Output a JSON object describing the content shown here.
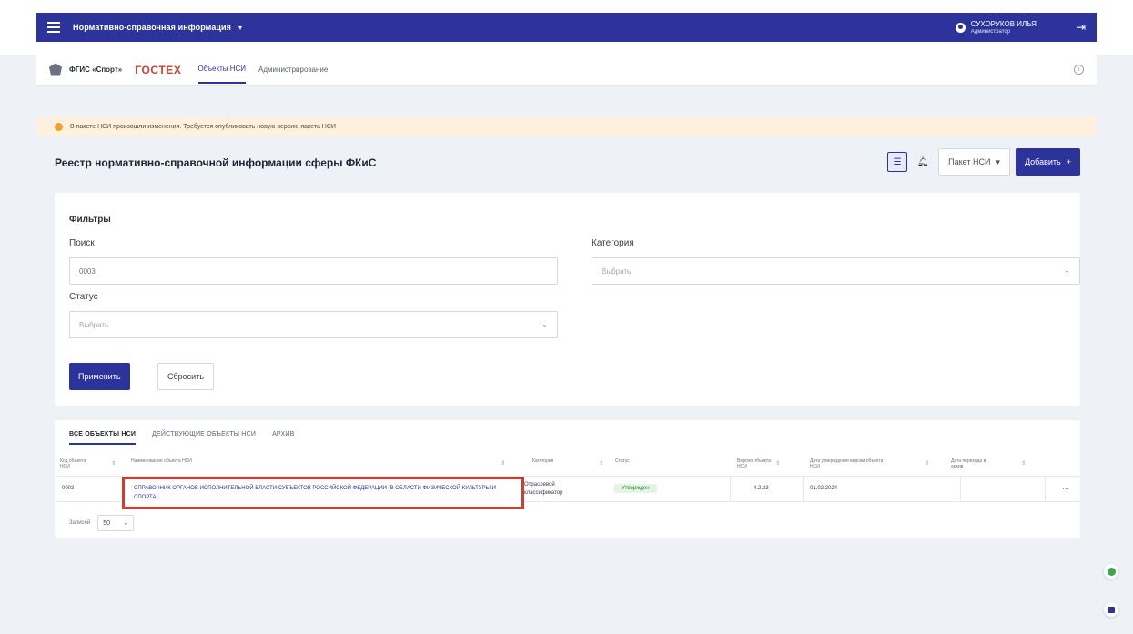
{
  "topbar": {
    "app_title": "Нормативно-справочная информация",
    "user_name": "СУХОРУКОВ ИЛЬЯ",
    "user_role": "Администратор"
  },
  "nav": {
    "brand": "ФГИС «Спорт»",
    "gostech": "ГОСТЕХ",
    "links": [
      "Объекты НСИ",
      "Администрирование"
    ]
  },
  "alert": {
    "text": "В пакете НСИ произошли изменения. Требуется опубликовать новую версию пакета НСИ"
  },
  "page": {
    "title": "Реестр нормативно-справочной информации сферы ФКиС",
    "package_label": "Пакет НСИ",
    "add_label": "Добавить"
  },
  "filters": {
    "title": "Фильтры",
    "search_label": "Поиск",
    "search_value": "0003",
    "category_label": "Категория",
    "category_placeholder": "Выбрать",
    "status_label": "Статус",
    "status_placeholder": "Выбрать",
    "apply_label": "Применить",
    "reset_label": "Сбросить"
  },
  "table": {
    "tabs": [
      "ВСЕ ОБЪЕКТЫ НСИ",
      "ДЕЙСТВУЮЩИЕ ОБЪЕКТЫ НСИ",
      "АРХИВ"
    ],
    "headers": {
      "code": "Код объекта НСИ",
      "name": "Наименование объекта НСИ",
      "category": "Категория",
      "status": "Статус",
      "version": "Версия объекта НСИ",
      "approval_date": "Дата утверждения версии объекта НСИ",
      "effective_date": "Дата перехода в архив"
    },
    "row": {
      "code": "0003",
      "name": "СПРАВОЧНИК ОРГАНОВ ИСПОЛНИТЕЛЬНОЙ ВЛАСТИ СУБЪЕКТОВ РОССИЙСКОЙ ФЕДЕРАЦИИ (В ОБЛАСТИ ФИЗИЧЕСКОЙ КУЛЬТУРЫ И СПОРТА)",
      "category": "Отраслевой классификатор",
      "status": "Утвержден",
      "version": "4.2.23",
      "approval_date": "01.02.2024",
      "effective_date": ""
    },
    "pager_label": "Записей",
    "page_size": "50"
  }
}
